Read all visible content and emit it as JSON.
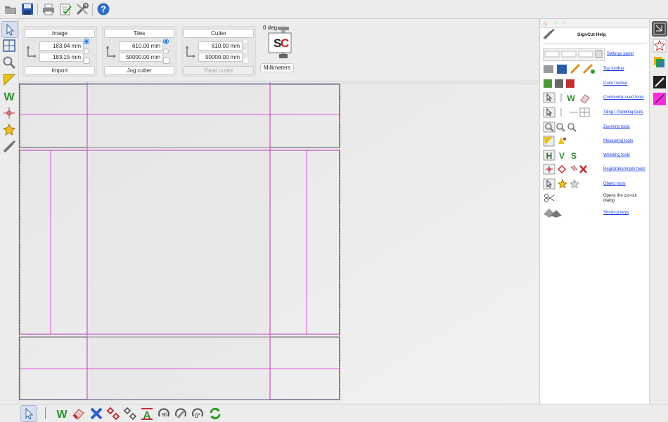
{
  "top_toolbar": {
    "icons": [
      "open-folder-icon",
      "save-icon",
      "print-icon",
      "checklist-icon",
      "tools-icon",
      "help-icon"
    ]
  },
  "settings_panel": {
    "image": {
      "label": "Image",
      "width": "183.04 mm",
      "height": "183.15 mm",
      "button": "Import"
    },
    "tiles": {
      "label": "Tiles",
      "width": "610.00 mm",
      "height": "50000.00 mm",
      "button": "Jog cutter"
    },
    "cutter": {
      "label": "Cutter",
      "width": "610.00 mm",
      "height": "50000.00 mm",
      "button": "Read cutter"
    },
    "rotation": "0 deg",
    "units_button": "Millimeters",
    "logo_text": "SC"
  },
  "help_panel": {
    "title": "SignCut Help",
    "items": [
      {
        "label": "Settings panel",
        "type": "link"
      },
      {
        "label": "Top toolbar",
        "type": "link"
      },
      {
        "label": "Color toolbar",
        "type": "link"
      },
      {
        "label": "Commonly used tools",
        "type": "link"
      },
      {
        "label": "Tiling / Paneling tools",
        "type": "link"
      },
      {
        "label": "Zooming tools",
        "type": "link"
      },
      {
        "label": "Measuring tools",
        "type": "link"
      },
      {
        "label": "Weeding tools",
        "type": "link"
      },
      {
        "label": "Registrationmark tools",
        "type": "link"
      },
      {
        "label": "Object tools",
        "type": "link"
      },
      {
        "label": "Opens the cut-out dialog",
        "type": "text"
      },
      {
        "label": "Shortcut keys",
        "type": "link"
      }
    ]
  },
  "colors": {
    "guide": "#dd22dd",
    "selection": "#2233cc",
    "link": "#1a40e0"
  }
}
